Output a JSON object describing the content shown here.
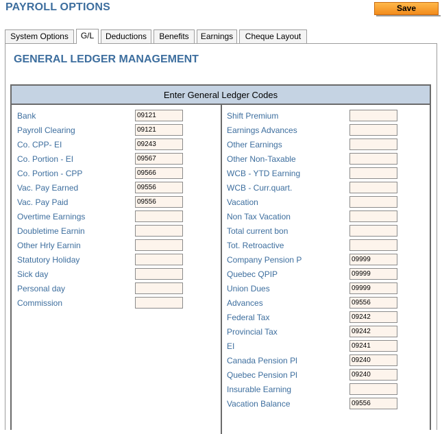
{
  "header": {
    "title": "PAYROLL OPTIONS",
    "save_label": "Save"
  },
  "tabs": [
    {
      "label": "System Options",
      "active": false
    },
    {
      "label": "G/L",
      "active": true
    },
    {
      "label": "Deductions",
      "active": false
    },
    {
      "label": "Benefits",
      "active": false
    },
    {
      "label": "Earnings",
      "active": false
    },
    {
      "label": "Cheque Layout",
      "active": false
    }
  ],
  "section": {
    "title": "GENERAL LEDGER MANAGEMENT",
    "table_header": "Enter General Ledger Codes"
  },
  "left_fields": [
    {
      "label": "Bank",
      "value": "09121"
    },
    {
      "label": "Payroll Clearing",
      "value": "09121"
    },
    {
      "label": "Co. CPP- EI",
      "value": "09243"
    },
    {
      "label": "Co. Portion - EI",
      "value": "09567"
    },
    {
      "label": "Co. Portion - CPP",
      "value": "09566"
    },
    {
      "label": "Vac. Pay Earned",
      "value": "09556"
    },
    {
      "label": "Vac. Pay Paid",
      "value": "09556"
    },
    {
      "label": "Overtime Earnings",
      "value": ""
    },
    {
      "label": "Doubletime Earnin",
      "value": ""
    },
    {
      "label": "Other Hrly Earnin",
      "value": ""
    },
    {
      "label": "Statutory Holiday",
      "value": ""
    },
    {
      "label": "Sick day",
      "value": ""
    },
    {
      "label": "Personal day",
      "value": ""
    },
    {
      "label": "Commission",
      "value": ""
    }
  ],
  "right_fields": [
    {
      "label": "Shift Premium",
      "value": ""
    },
    {
      "label": "Earnings Advances",
      "value": ""
    },
    {
      "label": "Other Earnings",
      "value": ""
    },
    {
      "label": "Other Non-Taxable",
      "value": ""
    },
    {
      "label": "WCB - YTD Earning",
      "value": ""
    },
    {
      "label": "WCB - Curr.quart.",
      "value": ""
    },
    {
      "label": "Vacation",
      "value": ""
    },
    {
      "label": "Non Tax Vacation",
      "value": ""
    },
    {
      "label": "Total current bon",
      "value": ""
    },
    {
      "label": "Tot. Retroactive",
      "value": ""
    },
    {
      "label": "Company Pension P",
      "value": "09999"
    },
    {
      "label": "Quebec QPIP",
      "value": "09999"
    },
    {
      "label": "Union Dues",
      "value": "09999"
    },
    {
      "label": "Advances",
      "value": "09556"
    },
    {
      "label": "Federal Tax",
      "value": "09242"
    },
    {
      "label": "Provincial Tax",
      "value": "09242"
    },
    {
      "label": "EI",
      "value": "09241"
    },
    {
      "label": "Canada Pension Pl",
      "value": "09240"
    },
    {
      "label": "Quebec Pension Pl",
      "value": "09240"
    },
    {
      "label": "Insurable Earning",
      "value": ""
    },
    {
      "label": "Vacation Balance",
      "value": "09556"
    }
  ]
}
